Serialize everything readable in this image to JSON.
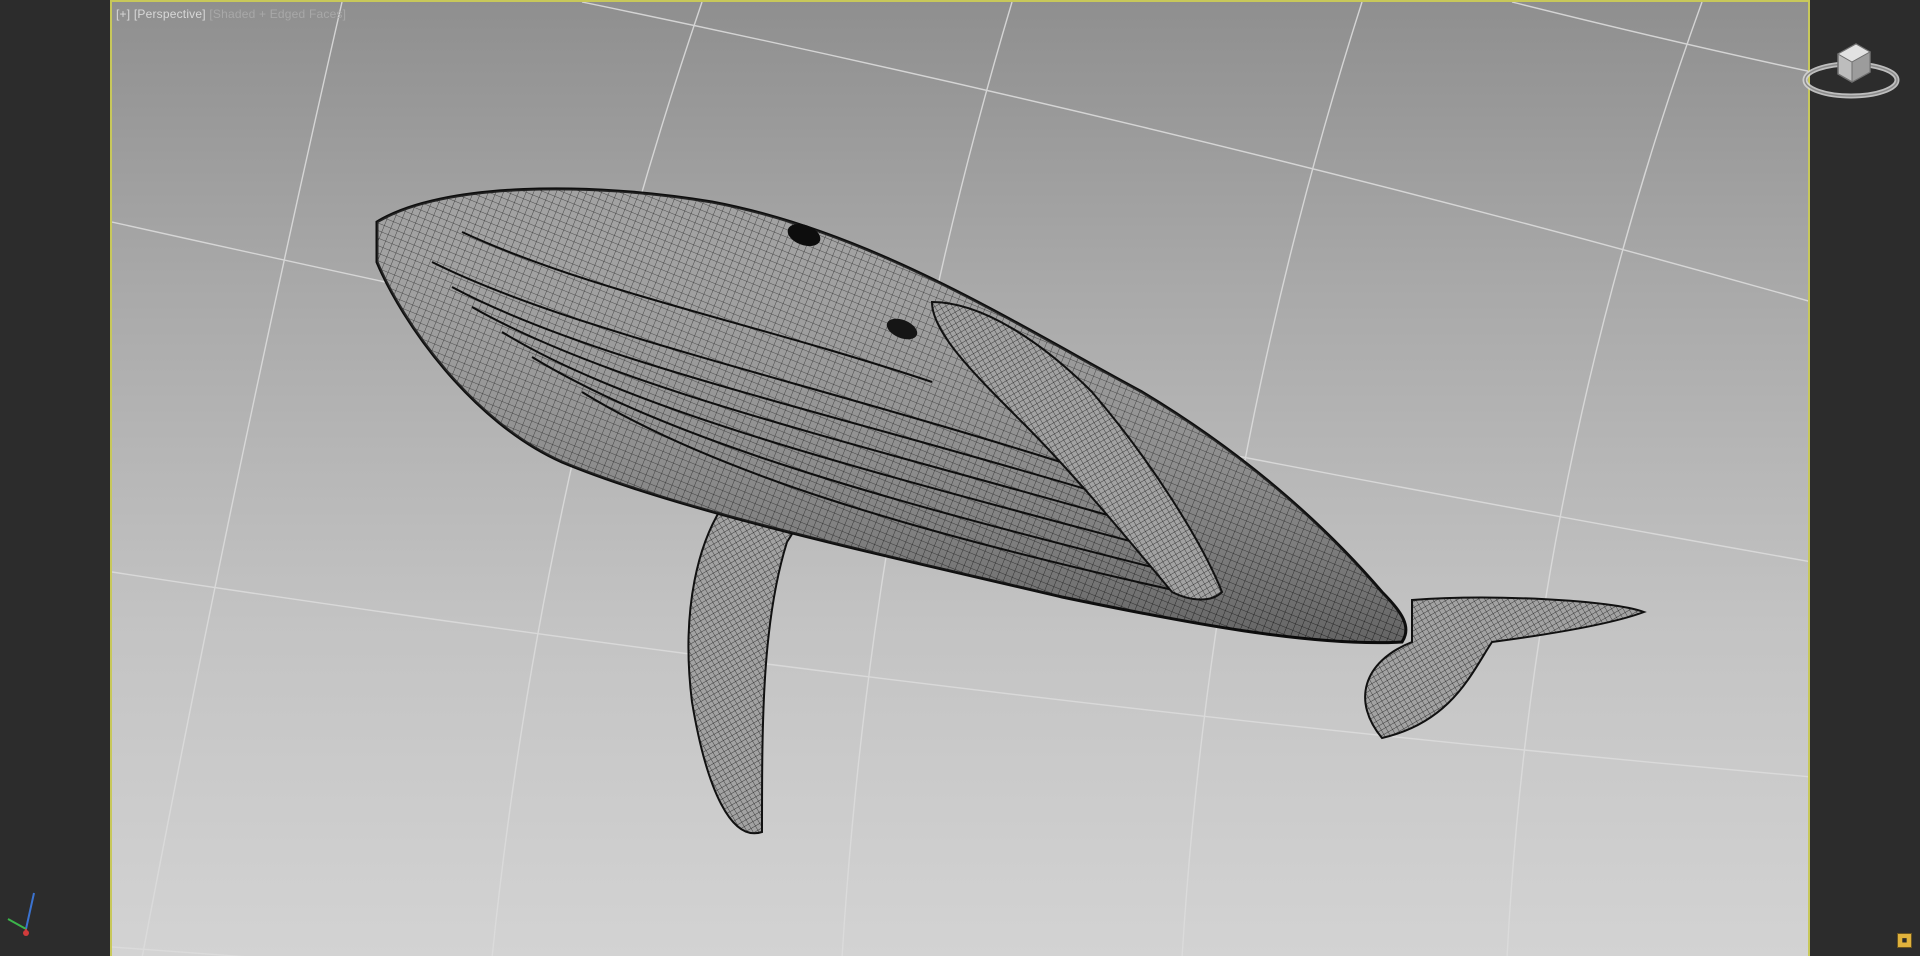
{
  "viewport": {
    "label": {
      "plus": "[+]",
      "view": "[Perspective]",
      "shading": "[Shaded + Edged Faces]"
    },
    "model": "humpback-whale-wireframe-mesh",
    "colors": {
      "active_border": "#c8c85a",
      "background_top": "#8f8f8f",
      "background_bottom": "#d3d3d3",
      "grid_line": "#dcdcdc",
      "wireframe": "#1c1c1c",
      "mesh_fill": "#9a9a9a",
      "ui_panel": "#2c2c2c",
      "axis_x": "#d13b3b",
      "axis_y": "#3cb44b",
      "axis_z": "#3b73d1"
    }
  },
  "widgets": {
    "viewcube_icon": "viewcube-icon",
    "axis_icon": "axis-tripod-icon",
    "badge_icon": "viewport-badge-icon"
  }
}
